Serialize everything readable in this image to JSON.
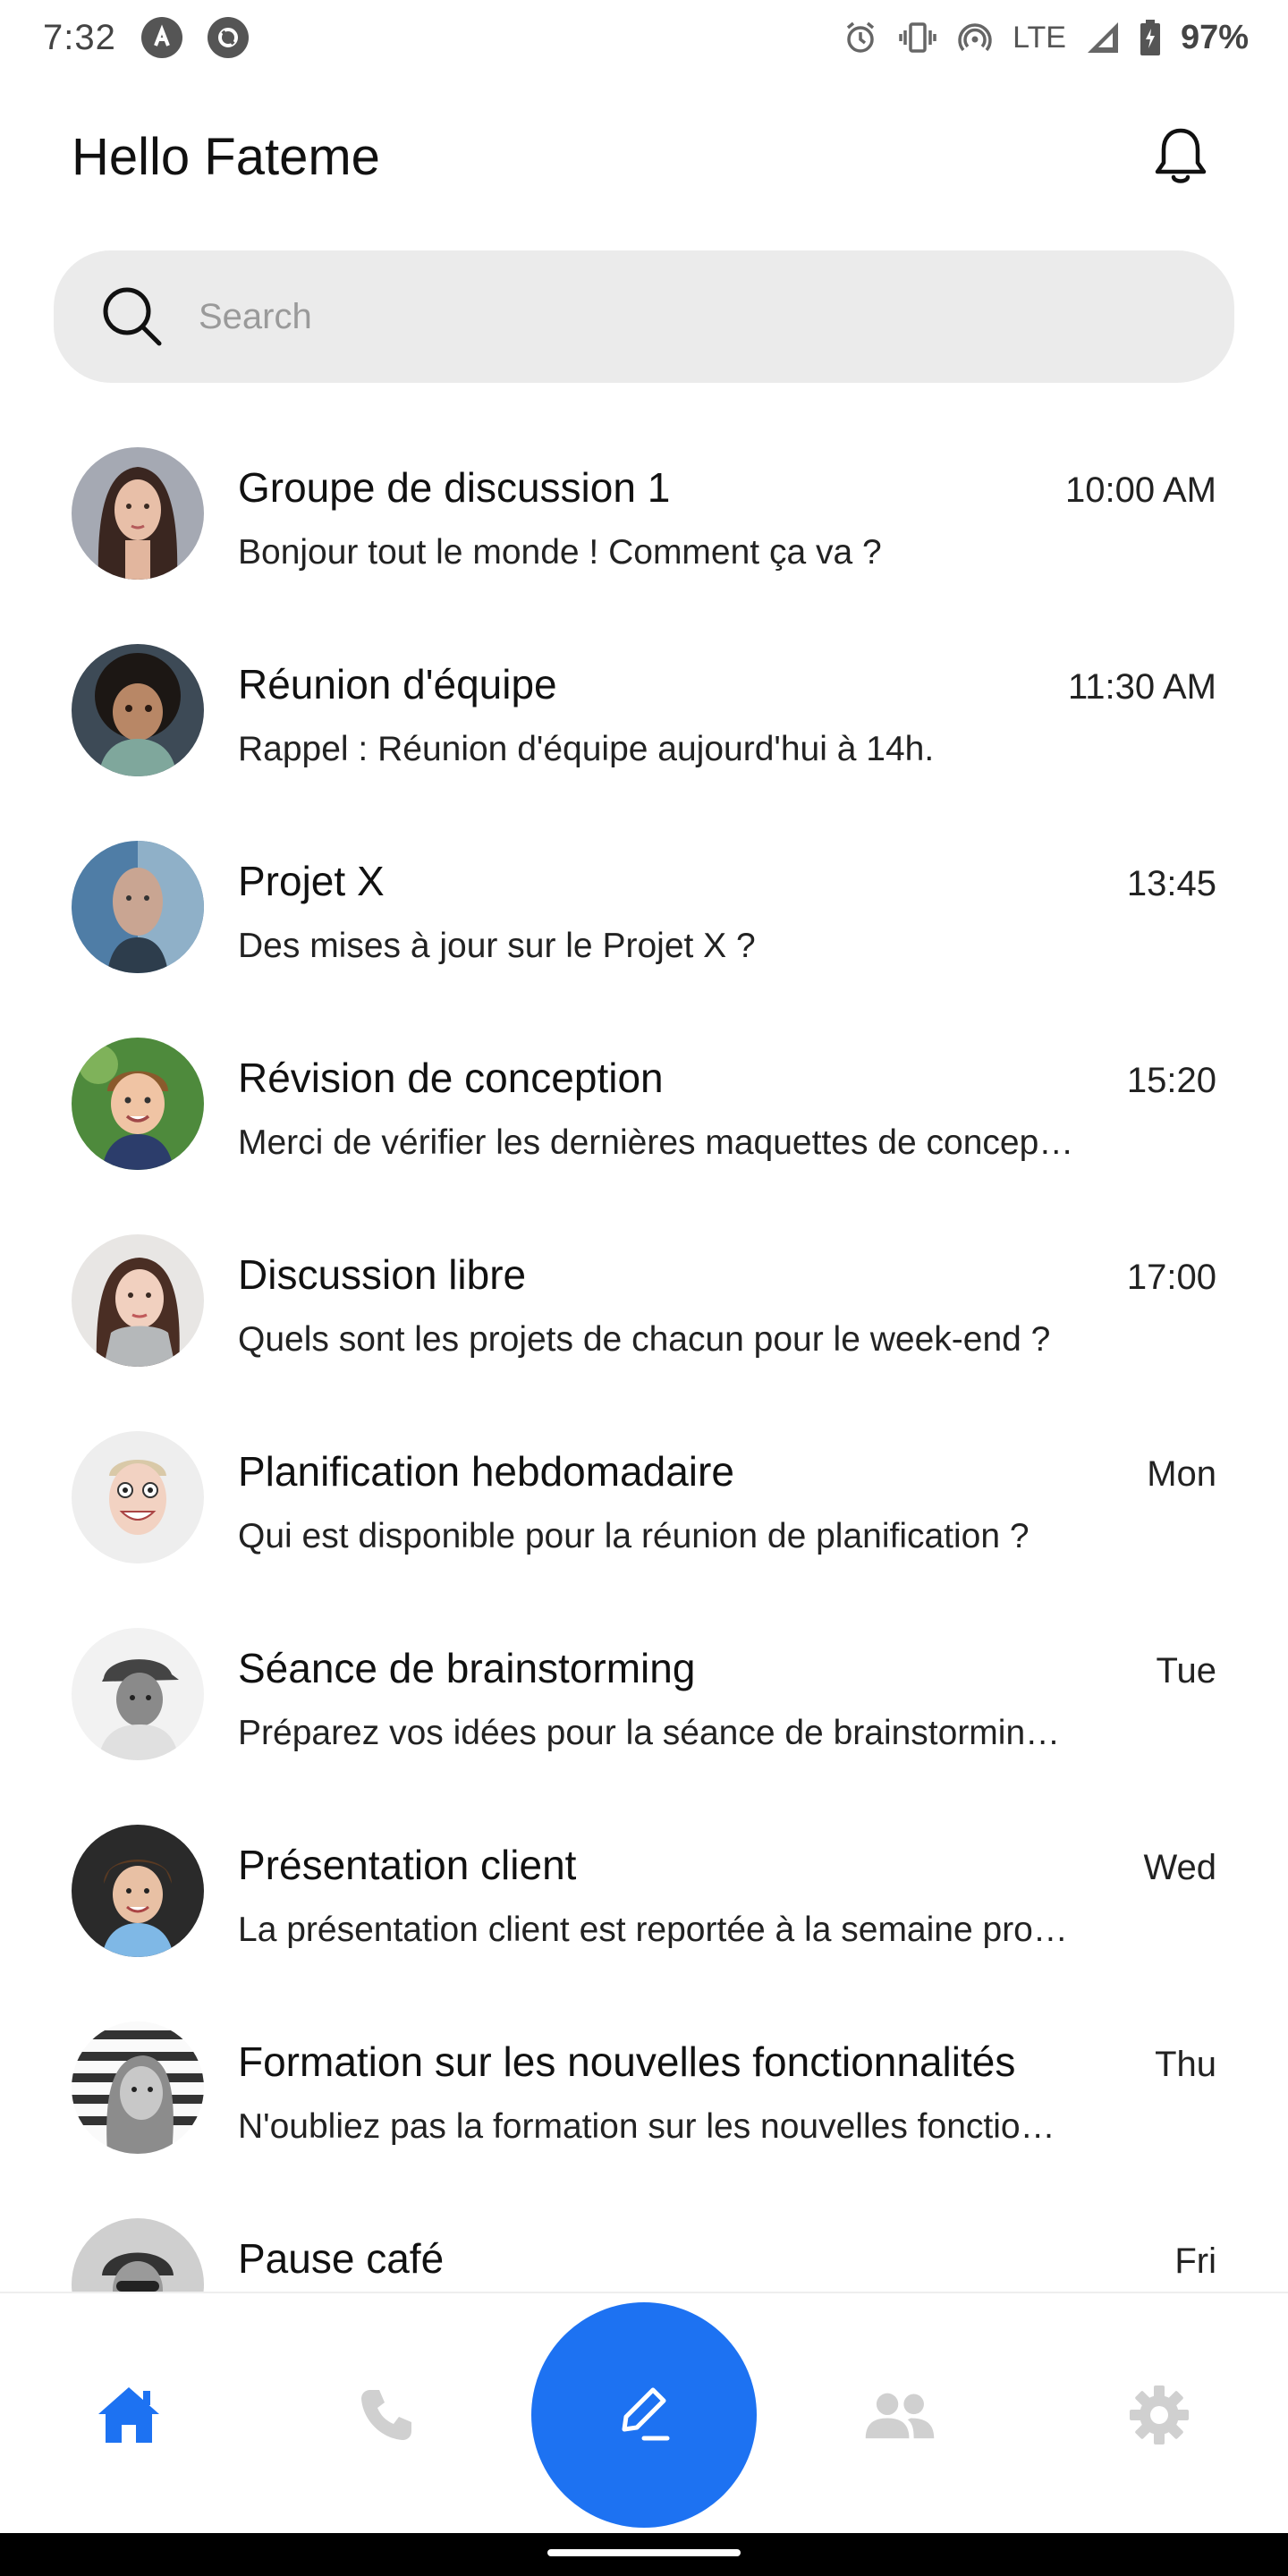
{
  "status_bar": {
    "time": "7:32",
    "network": "LTE",
    "battery": "97%"
  },
  "header": {
    "greeting": "Hello Fateme"
  },
  "search": {
    "placeholder": "Search"
  },
  "chats": [
    {
      "title": "Groupe de discussion 1",
      "time": "10:00 AM",
      "preview": "Bonjour tout le monde ! Comment ça va ?"
    },
    {
      "title": "Réunion d'équipe",
      "time": "11:30 AM",
      "preview": "Rappel : Réunion d'équipe aujourd'hui à 14h."
    },
    {
      "title": "Projet X",
      "time": "13:45",
      "preview": "Des mises à jour sur le Projet X ?"
    },
    {
      "title": "Révision de conception",
      "time": "15:20",
      "preview": "Merci de vérifier les dernières maquettes de concep…"
    },
    {
      "title": "Discussion libre",
      "time": "17:00",
      "preview": "Quels sont les projets de chacun pour le week-end ?"
    },
    {
      "title": "Planification hebdomadaire",
      "time": "Mon",
      "preview": "Qui est disponible pour la réunion de planification ?"
    },
    {
      "title": "Séance de brainstorming",
      "time": "Tue",
      "preview": "Préparez vos idées pour la séance de brainstormin…"
    },
    {
      "title": "Présentation client",
      "time": "Wed",
      "preview": "La présentation client est reportée à la semaine pro…"
    },
    {
      "title": "Formation sur les nouvelles fonctionnalités",
      "time": "Thu",
      "preview": "N'oubliez pas la formation sur les nouvelles fonctio…"
    },
    {
      "title": "Pause café",
      "time": "Fri",
      "preview": ""
    }
  ],
  "nav": {
    "items": [
      "home-icon",
      "phone-icon",
      "compose-icon",
      "people-icon",
      "settings-icon"
    ],
    "active": "home-icon"
  },
  "colors": {
    "accent": "#1d72f2",
    "inactive_icon": "#d0d0d0",
    "search_bg": "#ebebeb"
  }
}
